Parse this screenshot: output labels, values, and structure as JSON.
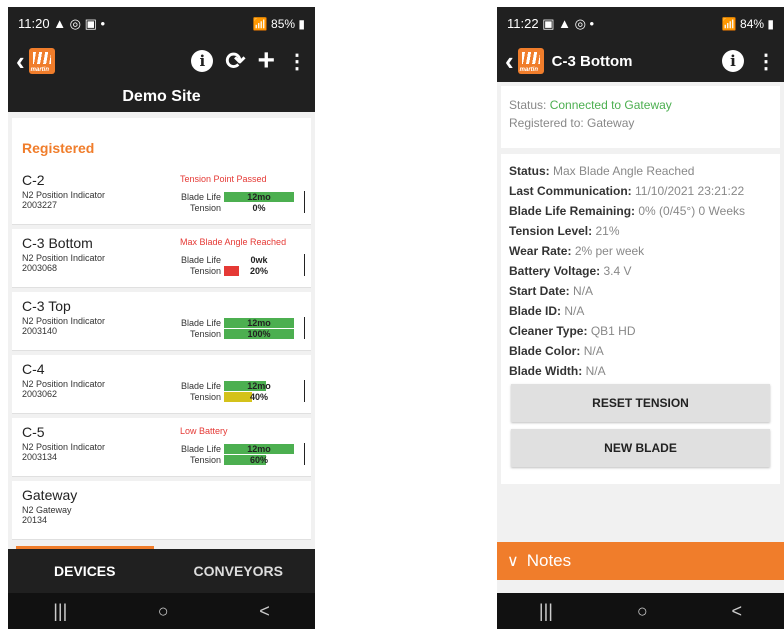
{
  "phone1": {
    "status_time": "11:20",
    "status_left_icons": "▲ ◎ ▣ •",
    "status_battery": "85%",
    "site_title": "Demo Site",
    "section_title": "Registered",
    "devices": [
      {
        "name": "C-2",
        "type": "N2 Position Indicator",
        "serial": "2003227",
        "alert": "Tension Point Passed",
        "blade_label": "Blade Life",
        "blade_value": "12mo",
        "blade_fill": 1.0,
        "blade_color": "#4caf50",
        "tension_label": "Tension",
        "tension_value": "0%",
        "tension_fill": 0.0,
        "tension_color": "#4caf50"
      },
      {
        "name": "C-3 Bottom",
        "type": "N2 Position Indicator",
        "serial": "2003068",
        "alert": "Max Blade Angle Reached",
        "blade_label": "Blade Life",
        "blade_value": "0wk",
        "blade_fill": 0.0,
        "blade_color": "#4caf50",
        "tension_label": "Tension",
        "tension_value": "20%",
        "tension_fill": 0.21,
        "tension_color": "#e53935"
      },
      {
        "name": "C-3 Top",
        "type": "N2 Position Indicator",
        "serial": "2003140",
        "alert": "",
        "blade_label": "Blade Life",
        "blade_value": "12mo",
        "blade_fill": 1.0,
        "blade_color": "#4caf50",
        "tension_label": "Tension",
        "tension_value": "100%",
        "tension_fill": 1.0,
        "tension_color": "#4caf50"
      },
      {
        "name": "C-4",
        "type": "N2 Position Indicator",
        "serial": "2003062",
        "alert": "",
        "blade_label": "Blade Life",
        "blade_value": "12mo",
        "blade_fill": 0.6,
        "blade_color": "#4caf50",
        "tension_label": "Tension",
        "tension_value": "40%",
        "tension_fill": 0.4,
        "tension_color": "#d4c21a"
      },
      {
        "name": "C-5",
        "type": "N2 Position Indicator",
        "serial": "2003134",
        "alert": "Low Battery",
        "blade_label": "Blade Life",
        "blade_value": "12mo",
        "blade_fill": 1.0,
        "blade_color": "#4caf50",
        "tension_label": "Tension",
        "tension_value": "60%",
        "tension_fill": 0.6,
        "tension_color": "#4caf50"
      }
    ],
    "gateway": {
      "name": "Gateway",
      "type": "N2 Gateway",
      "serial": "20134"
    },
    "tabs": [
      "DEVICES",
      "CONVEYORS"
    ],
    "nav": [
      "|||",
      "○",
      "<"
    ]
  },
  "phone2": {
    "status_time": "11:22",
    "status_left_icons": "▣ ▲ ◎ •",
    "status_battery": "84%",
    "title": "C-3 Bottom",
    "status_label": "Status:",
    "status_value": "Connected to Gateway",
    "registered_text": "Registered to: Gateway",
    "details": [
      {
        "key": "Status:",
        "value": "Max Blade Angle Reached"
      },
      {
        "key": "Last Communication:",
        "value": "11/10/2021 23:21:22"
      },
      {
        "key": "Blade Life Remaining:",
        "value": "0% (0/45°)    0 Weeks"
      },
      {
        "key": "Tension Level:",
        "value": "21%"
      },
      {
        "key": "Wear Rate:",
        "value": "2% per week"
      },
      {
        "key": "Battery Voltage:",
        "value": "3.4 V"
      },
      {
        "key": "Start Date:",
        "value": "N/A"
      },
      {
        "key": "Blade ID:",
        "value": "N/A"
      },
      {
        "key": "Cleaner Type:",
        "value": "QB1 HD"
      },
      {
        "key": "Blade Color:",
        "value": "N/A"
      },
      {
        "key": "Blade Width:",
        "value": "N/A"
      }
    ],
    "buttons": {
      "reset": "RESET TENSION",
      "new_blade": "NEW BLADE"
    },
    "notes": "Notes",
    "nav": [
      "|||",
      "○",
      "<"
    ]
  },
  "colors": {
    "accent": "#f07d2b",
    "bar": "#202020",
    "ok": "#4caf50",
    "alert": "#e53935"
  },
  "icons": [
    "back-icon",
    "martin-logo",
    "info-icon",
    "refresh-icon",
    "plus-icon",
    "kebab-icon",
    "chevron-down-icon"
  ]
}
